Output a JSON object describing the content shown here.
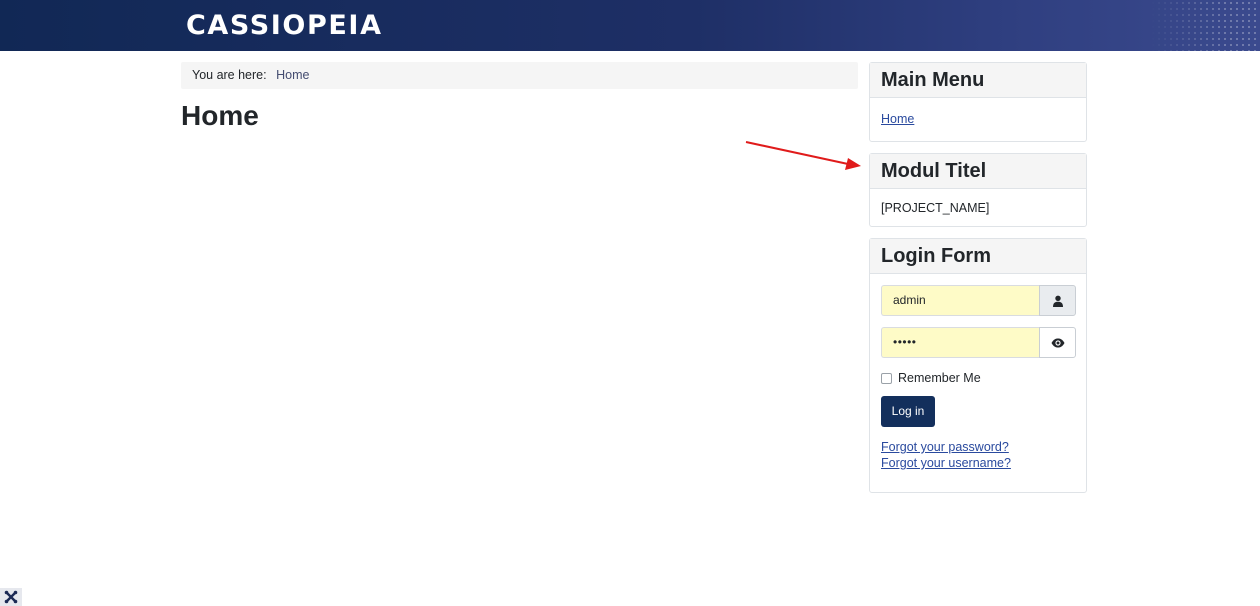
{
  "header": {
    "brand": "CASSIOPEIA"
  },
  "breadcrumb": {
    "label": "You are here:",
    "current": "Home"
  },
  "page": {
    "title": "Home"
  },
  "modules": {
    "main_menu": {
      "title": "Main Menu",
      "items": [
        {
          "label": "Home"
        }
      ]
    },
    "modul_titel": {
      "title": "Modul Titel",
      "text": "[PROJECT_NAME]"
    },
    "login_form": {
      "title": "Login Form",
      "username_value": "admin",
      "password_mask": "•••••",
      "username_icon": "user-icon",
      "password_icon": "eye-icon",
      "remember_label": "Remember Me",
      "remember_checked": false,
      "login_label": "Log in",
      "forgot_password": "Forgot your password?",
      "forgot_username": "Forgot your username?"
    }
  },
  "annotation": {
    "arrow_color": "#e01b1b"
  },
  "colors": {
    "header_bg": "#1e2f66",
    "button_bg": "#132f5c",
    "link": "#2a4a9e",
    "input_autofill_bg": "#fefbc7"
  },
  "footer": {
    "icon": "joomla-icon"
  }
}
